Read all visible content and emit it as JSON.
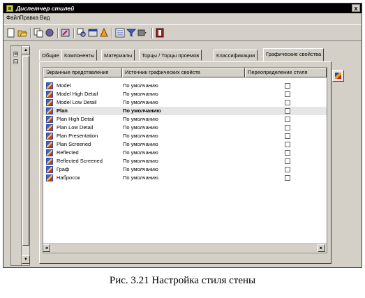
{
  "window": {
    "title": "Диспетчер стилей",
    "close_glyph": "x"
  },
  "menu": [
    "Файл",
    "Правка",
    "Вид"
  ],
  "toolbar": {
    "icons": [
      "new-icon",
      "open-icon",
      "copy-icon",
      "color-icon",
      "edit-icon",
      "filter-icon",
      "dialog-icon",
      "cleanup-icon",
      "properties-icon",
      "funnel-icon",
      "view-icon",
      "book-icon"
    ]
  },
  "tree": {
    "expand_1": "⊞",
    "expand_2": "⊟",
    "scroll_up": "▲",
    "scroll_down": "▼"
  },
  "tabs": [
    "Общие",
    "Компоненты",
    "Материалы",
    "Торцы / Торцы проемов",
    "Классификации",
    "Графические свойства"
  ],
  "active_tab": "Графические свойства",
  "table": {
    "columns": [
      "Экранные представления",
      "Источник графических свойств",
      "Переопределение стиля"
    ],
    "rows": [
      {
        "name": "Model",
        "source": "По умолчанию",
        "override": false,
        "selected": false
      },
      {
        "name": "Model High Detail",
        "source": "По умолчанию",
        "override": false,
        "selected": false
      },
      {
        "name": "Model Low Detail",
        "source": "По умолчанию",
        "override": false,
        "selected": false
      },
      {
        "name": "Plan",
        "source": "По умолчанию",
        "override": false,
        "selected": true
      },
      {
        "name": "Plan High Detail",
        "source": "По умолчанию",
        "override": false,
        "selected": false
      },
      {
        "name": "Plan Low Detail",
        "source": "По умолчанию",
        "override": false,
        "selected": false
      },
      {
        "name": "Plan Presentation",
        "source": "По умолчанию",
        "override": false,
        "selected": false
      },
      {
        "name": "Plan Screened",
        "source": "По умолчанию",
        "override": false,
        "selected": false
      },
      {
        "name": "Reflected",
        "source": "По умолчанию",
        "override": false,
        "selected": false
      },
      {
        "name": "Reflected Screened",
        "source": "По умолчанию",
        "override": false,
        "selected": false
      },
      {
        "name": "Граф",
        "source": "По умолчанию",
        "override": false,
        "selected": false
      },
      {
        "name": "Набросок",
        "source": "По умолчанию",
        "override": false,
        "selected": false
      }
    ]
  },
  "scroll": {
    "left": "◄",
    "right": "►"
  },
  "caption": "Рис. 3.21 Настройка стиля стены"
}
